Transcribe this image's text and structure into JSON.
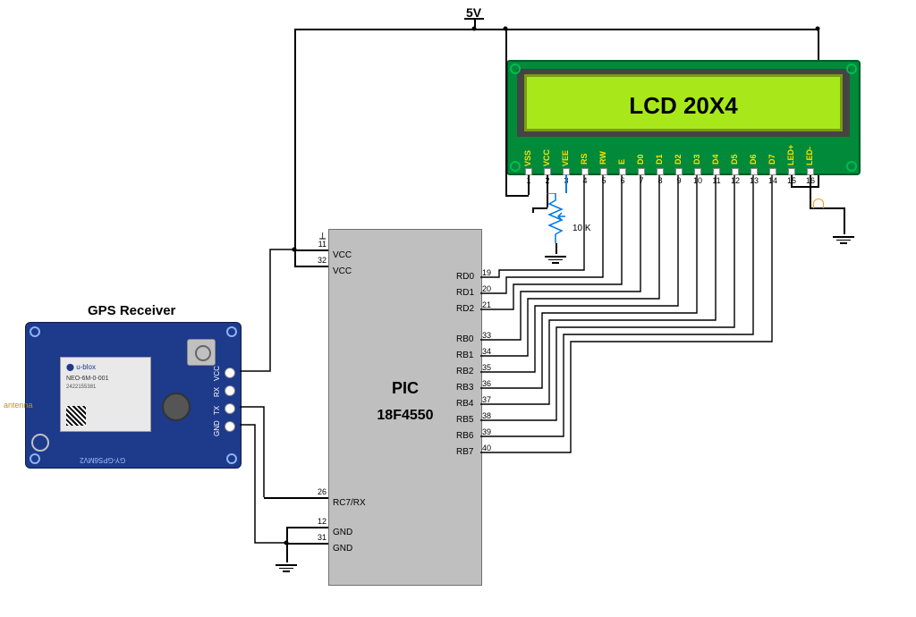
{
  "power_label": "5V",
  "pot_label": "10 K",
  "gps_title": "GPS Receiver",
  "gps": {
    "board_text": "GY-GPS6MV2",
    "chip_brand": "u-blox",
    "chip_model": "NEO-6M-0-001",
    "chip_serial": "2422155381",
    "antenna_text": "antenna",
    "pins": [
      "VCC",
      "RX",
      "TX",
      "GND"
    ]
  },
  "lcd": {
    "title": "LCD 20X4",
    "pins": [
      {
        "n": "1",
        "name": "VSS"
      },
      {
        "n": "2",
        "name": "VCC"
      },
      {
        "n": "3",
        "name": "VEE"
      },
      {
        "n": "4",
        "name": "RS"
      },
      {
        "n": "5",
        "name": "RW"
      },
      {
        "n": "6",
        "name": "E"
      },
      {
        "n": "7",
        "name": "D0"
      },
      {
        "n": "8",
        "name": "D1"
      },
      {
        "n": "9",
        "name": "D2"
      },
      {
        "n": "10",
        "name": "D3"
      },
      {
        "n": "11",
        "name": "D4"
      },
      {
        "n": "12",
        "name": "D5"
      },
      {
        "n": "13",
        "name": "D6"
      },
      {
        "n": "14",
        "name": "D7"
      },
      {
        "n": "15",
        "name": "LED+"
      },
      {
        "n": "16",
        "name": "LED-"
      }
    ]
  },
  "pic": {
    "title1": "PIC",
    "title2": "18F4550",
    "left_pins": [
      {
        "num": "11",
        "name": "VCC"
      },
      {
        "num": "32",
        "name": "VCC"
      },
      {
        "num": "26",
        "name": "RC7/RX"
      },
      {
        "num": "12",
        "name": "GND"
      },
      {
        "num": "31",
        "name": "GND"
      }
    ],
    "right_pins": [
      {
        "num": "19",
        "name": "RD0"
      },
      {
        "num": "20",
        "name": "RD1"
      },
      {
        "num": "21",
        "name": "RD2"
      },
      {
        "num": "33",
        "name": "RB0"
      },
      {
        "num": "34",
        "name": "RB1"
      },
      {
        "num": "35",
        "name": "RB2"
      },
      {
        "num": "36",
        "name": "RB3"
      },
      {
        "num": "37",
        "name": "RB4"
      },
      {
        "num": "38",
        "name": "RB5"
      },
      {
        "num": "39",
        "name": "RB6"
      },
      {
        "num": "40",
        "name": "RB7"
      }
    ]
  },
  "connections": [
    "LCD.VSS → GND (via 5V rail ground)",
    "LCD.VCC → 5V",
    "LCD.VEE → 10K pot wiper (pot ends → 5V rail, GND)",
    "LCD.RS → PIC.RD0 (pin 19)",
    "LCD.RW → PIC.RD1 (pin 20)",
    "LCD.E  → PIC.RD2 (pin 21)",
    "LCD.D0 → PIC.RB0 (pin 33)",
    "LCD.D1 → PIC.RB1 (pin 34)",
    "LCD.D2 → PIC.RB2 (pin 35)",
    "LCD.D3 → PIC.RB3 (pin 36)",
    "LCD.D4 → PIC.RB4 (pin 37)",
    "LCD.D5 → PIC.RB5 (pin 38)",
    "LCD.D6 → PIC.RB6 (pin 39)",
    "LCD.D7 → PIC.RB7 (pin 40)",
    "LCD.LED+ → 5V",
    "LCD.LED- → GND",
    "PIC.VCC (11,32) → 5V",
    "PIC.GND (12,31) → GND",
    "PIC.RC7/RX (26) → GPS.TX",
    "GPS.VCC → 5V",
    "GPS.GND → GND"
  ]
}
